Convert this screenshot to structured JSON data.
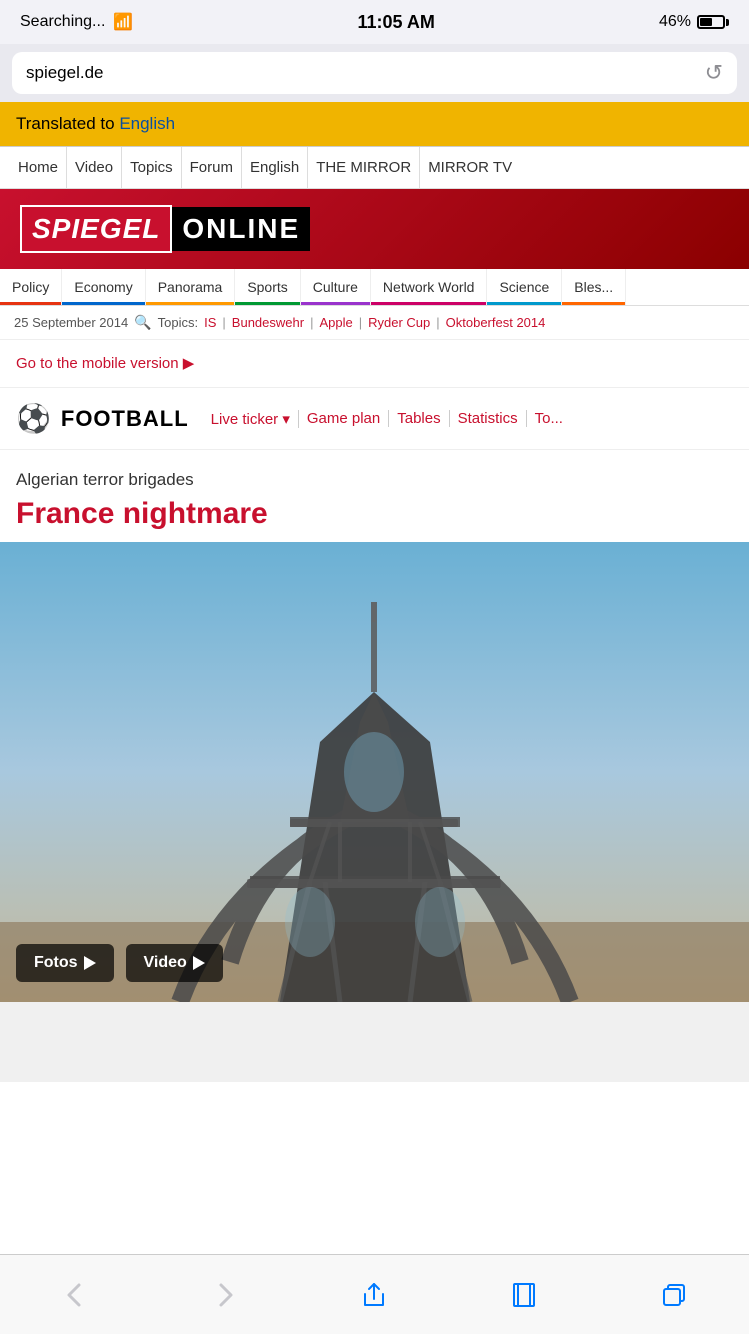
{
  "status": {
    "carrier": "Searching...",
    "wifi": "📶",
    "time": "11:05 AM",
    "battery_pct": "46%"
  },
  "address_bar": {
    "url": "spiegel.de",
    "reload_label": "↺"
  },
  "translation_banner": {
    "text": "Translated to ",
    "language": "English"
  },
  "top_nav": {
    "items": [
      {
        "label": "Home"
      },
      {
        "label": "Video"
      },
      {
        "label": "Topics"
      },
      {
        "label": "Forum"
      },
      {
        "label": "English"
      },
      {
        "label": "THE MIRROR"
      },
      {
        "label": "MIRROR TV"
      }
    ]
  },
  "logo": {
    "part1": "SPIEGEL",
    "part2": "ONLINE"
  },
  "cat_nav": {
    "items": [
      {
        "label": "Policy",
        "class": "policy"
      },
      {
        "label": "Economy",
        "class": "economy"
      },
      {
        "label": "Panorama",
        "class": "panorama"
      },
      {
        "label": "Sports",
        "class": "sports"
      },
      {
        "label": "Culture",
        "class": "culture"
      },
      {
        "label": "Network World",
        "class": "network"
      },
      {
        "label": "Science",
        "class": "science"
      },
      {
        "label": "Bles...",
        "class": "bles"
      }
    ]
  },
  "date_bar": {
    "date": "25 September 2014",
    "topics_label": "Topics:",
    "topics": [
      "IS",
      "Bundeswehr",
      "Apple",
      "Ryder Cup",
      "Oktoberfest 2014"
    ]
  },
  "mobile_link": {
    "text": "Go to the mobile version ▶"
  },
  "football": {
    "icon": "⚽",
    "title": "FOOTBALL",
    "nav": [
      {
        "label": "Live ticker ▾"
      },
      {
        "label": "Game plan"
      },
      {
        "label": "Tables"
      },
      {
        "label": "Statistics"
      },
      {
        "label": "To..."
      }
    ]
  },
  "article": {
    "subtitle": "Algerian terror brigades",
    "title": "France nightmare",
    "fotos_btn": "Fotos",
    "video_btn": "Video"
  },
  "bottom_toolbar": {
    "back_label": "<",
    "forward_label": ">",
    "share_label": "share",
    "bookmarks_label": "bookmarks",
    "tabs_label": "tabs"
  }
}
